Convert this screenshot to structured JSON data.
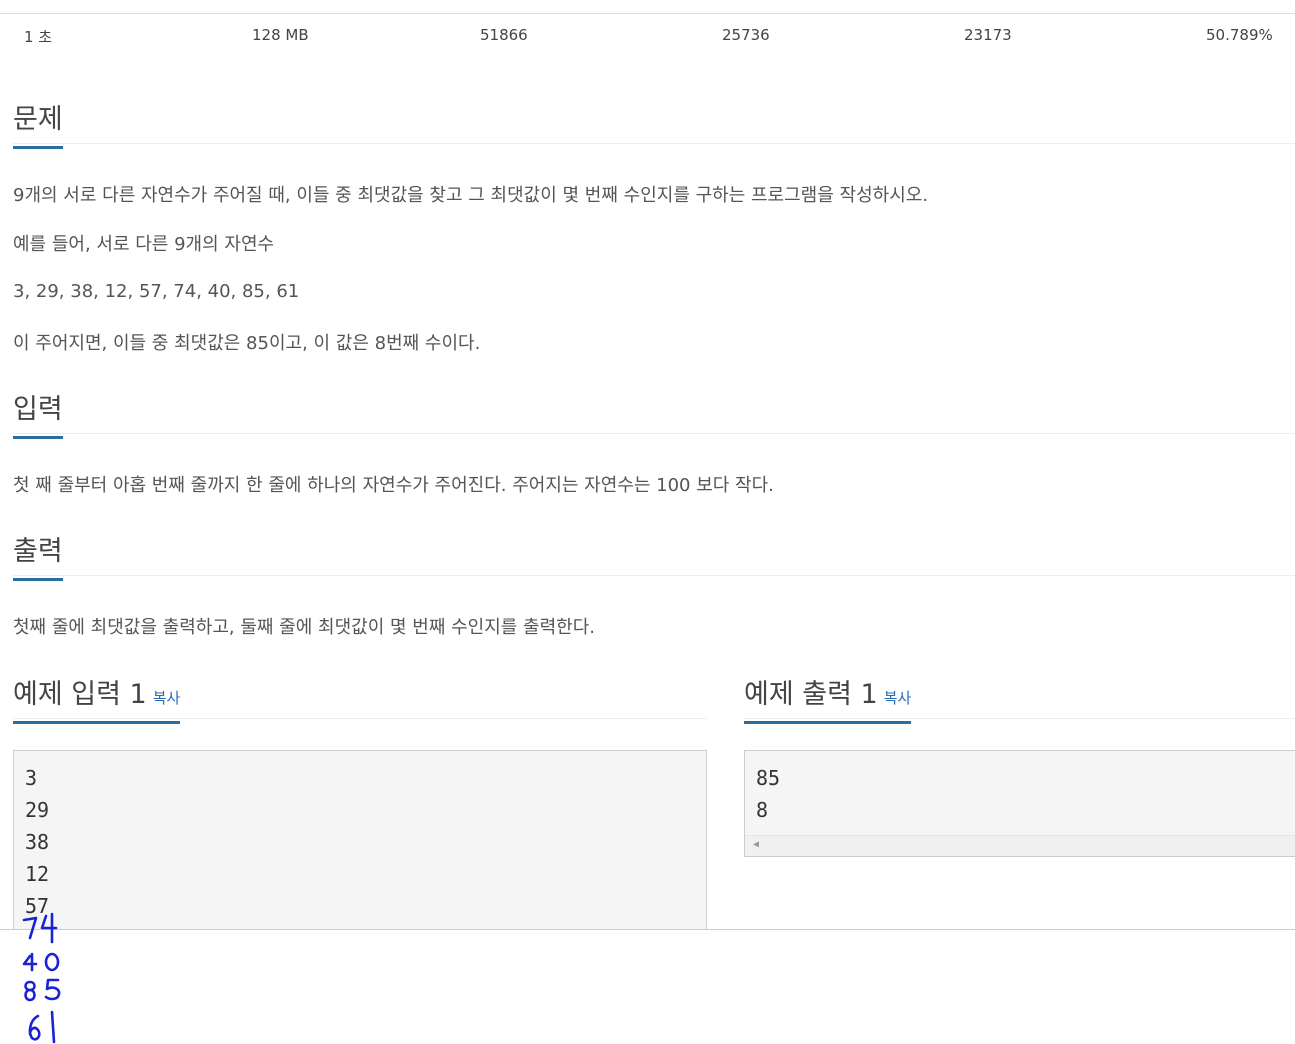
{
  "stats": [
    "1 초",
    "128 MB",
    "51866",
    "25736",
    "23173",
    "50.789%"
  ],
  "problem": {
    "heading": "문제",
    "paragraphs": [
      "9개의 서로 다른 자연수가 주어질 때, 이들 중 최댓값을 찾고 그 최댓값이 몇 번째 수인지를 구하는 프로그램을 작성하시오.",
      "예를 들어, 서로 다른 9개의 자연수",
      "3, 29, 38, 12, 57, 74, 40, 85, 61",
      "이 주어지면, 이들 중 최댓값은 85이고, 이 값은 8번째 수이다."
    ]
  },
  "input": {
    "heading": "입력",
    "text": "첫 째 줄부터 아홉 번째 줄까지 한 줄에 하나의 자연수가 주어진다. 주어지는 자연수는 100 보다 작다."
  },
  "output": {
    "heading": "출력",
    "text": "첫째 줄에 최댓값을 출력하고, 둘째 줄에 최댓값이 몇 번째 수인지를 출력한다."
  },
  "sample_input": {
    "title": "예제 입력 1",
    "copy_label": "복사",
    "lines": [
      "3",
      "29",
      "38",
      "12",
      "57"
    ]
  },
  "sample_output": {
    "title": "예제 출력 1",
    "copy_label": "복사",
    "lines": [
      "85",
      "8"
    ]
  },
  "handwritten_numbers": [
    "74",
    "40",
    "85",
    "61"
  ],
  "colors": {
    "accent": "#2a6e9e",
    "link": "#2a6ebb",
    "handwriting": "#1a22d6"
  }
}
